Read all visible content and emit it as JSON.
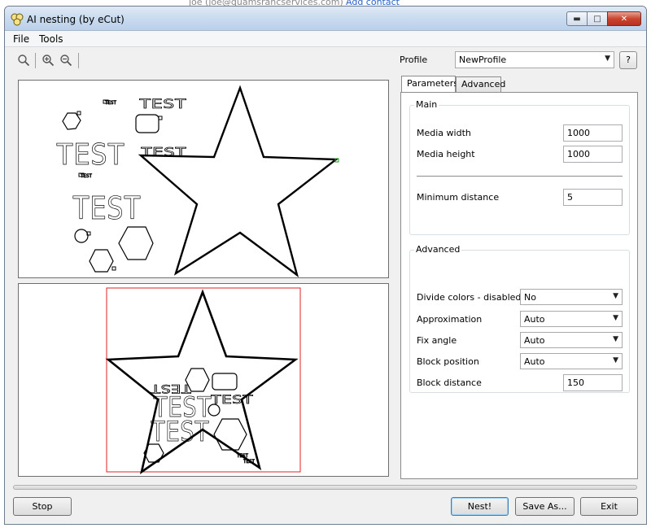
{
  "background": {
    "email_text": "joe (joe@quamsrancservices.com)",
    "add_contact": "Add contact"
  },
  "window": {
    "title": "AI nesting (by eCut)"
  },
  "menu": {
    "file": "File",
    "tools": "Tools"
  },
  "profile": {
    "label": "Profile",
    "selected": "NewProfile",
    "help_label": "?"
  },
  "tabs": {
    "parameters": "Parameters",
    "advanced": "Advanced"
  },
  "main_group": {
    "title": "Main",
    "media_width_label": "Media width",
    "media_width_value": "1000",
    "media_height_label": "Media height",
    "media_height_value": "1000",
    "min_distance_label": "Minimum distance",
    "min_distance_value": "5"
  },
  "advanced_group": {
    "title": "Advanced",
    "divide_colors_label": "Divide colors - disabled",
    "divide_colors_value": "No",
    "approximation_label": "Approximation",
    "approximation_value": "Auto",
    "fix_angle_label": "Fix angle",
    "fix_angle_value": "Auto",
    "block_position_label": "Block position",
    "block_position_value": "Auto",
    "block_distance_label": "Block distance",
    "block_distance_value": "150"
  },
  "canvas_text": {
    "test": "TEST",
    "test_small": "TEST"
  },
  "buttons": {
    "stop": "Stop",
    "nest": "Nest!",
    "save_as": "Save As...",
    "exit": "Exit"
  },
  "colors": {
    "sheet_border": "#e02020",
    "handle": "#1a9a1a"
  }
}
